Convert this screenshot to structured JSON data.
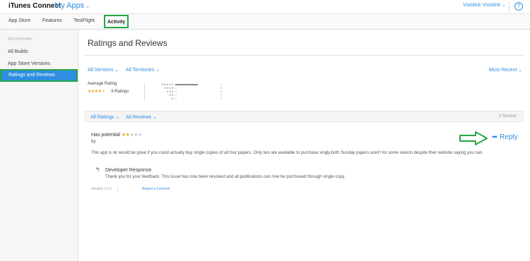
{
  "header": {
    "brand": "iTunes Connect",
    "app_menu": "My Apps",
    "user": "Visiolink Visiolink",
    "help": "?"
  },
  "tabs": [
    {
      "label": "App Store"
    },
    {
      "label": "Features"
    },
    {
      "label": "TestFlight"
    },
    {
      "label": "Activity",
      "active": true
    }
  ],
  "sidebar": {
    "section": "iOS HISTORY",
    "items": [
      {
        "label": "All Builds"
      },
      {
        "label": "App Store Versions"
      },
      {
        "label": "Ratings and Reviews",
        "active": true
      }
    ]
  },
  "main": {
    "title": "Ratings and Reviews",
    "filters": {
      "versions": "All Versions",
      "territories": "All Territories",
      "sort": "Most Recent"
    },
    "summary": {
      "label": "Average Rating",
      "ratings_count": "4 Ratings",
      "average_stars": 4.5,
      "histogram": [
        {
          "stars": "★★★★★",
          "count": "2",
          "fill": 1.0
        },
        {
          "stars": "★★★★",
          "count": "0",
          "fill": 0.0
        },
        {
          "stars": "★★★",
          "count": "0",
          "fill": 0.0
        },
        {
          "stars": "★★",
          "count": "0",
          "fill": 0.0
        },
        {
          "stars": "★",
          "count": "0",
          "fill": 0.0
        }
      ]
    },
    "review_filters": {
      "ratings": "All Ratings",
      "reviews": "All Reviews",
      "count": "1 Review"
    },
    "review": {
      "title": "Has potential",
      "stars": 2,
      "by": "by",
      "body": "This app is ok would be great if you could actually buy single copies of all four papers. Only two are available to purchase singly,both Sunday papers aren't for some reason despite their website saying you can.",
      "reply_label": "Reply",
      "developer_response": {
        "title": "Developer Response",
        "text": "Thank you for your feedback. This issue has now been resolved and all publications can now be purchased through single copy."
      },
      "version": "Version 1.0.1",
      "report": "Report a Concern"
    }
  },
  "colors": {
    "accent": "#2f8ee0",
    "highlight": "#28a745",
    "star": "#f0a020"
  }
}
